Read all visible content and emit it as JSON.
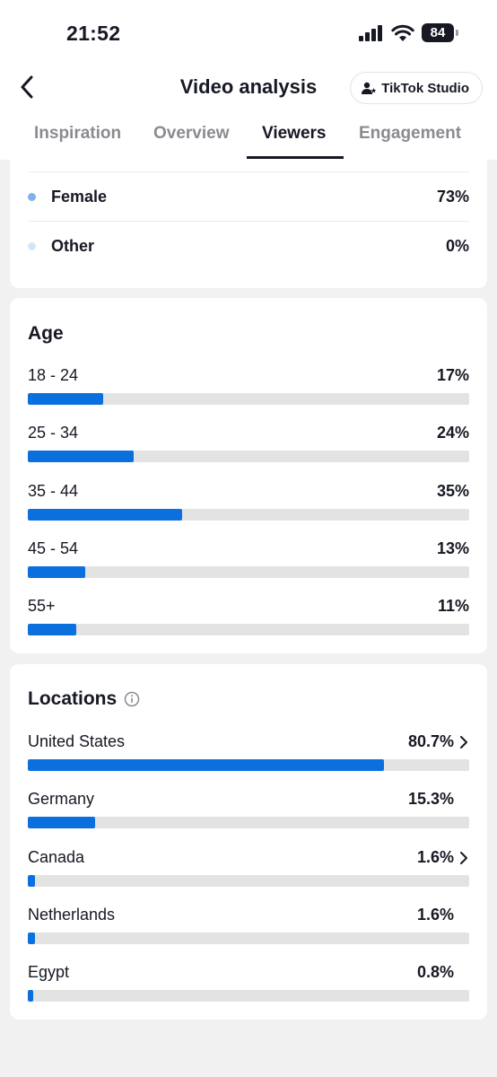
{
  "status_bar": {
    "time": "21:52",
    "battery": "84"
  },
  "header": {
    "title": "Video analysis",
    "studio_button": "TikTok Studio"
  },
  "tabs": [
    {
      "label": "Inspiration",
      "active": false
    },
    {
      "label": "Overview",
      "active": false
    },
    {
      "label": "Viewers",
      "active": true
    },
    {
      "label": "Engagement",
      "active": false
    }
  ],
  "gender": {
    "rows": [
      {
        "label": "Female",
        "value": "73%",
        "dot_color": "#7fb2e8"
      },
      {
        "label": "Other",
        "value": "0%",
        "dot_color": "#d4e5f8"
      }
    ]
  },
  "age": {
    "title": "Age",
    "rows": [
      {
        "label": "18 - 24",
        "value": "17%",
        "fraction": 0.17
      },
      {
        "label": "25 - 34",
        "value": "24%",
        "fraction": 0.24
      },
      {
        "label": "35 - 44",
        "value": "35%",
        "fraction": 0.35
      },
      {
        "label": "45 - 54",
        "value": "13%",
        "fraction": 0.13
      },
      {
        "label": "55+",
        "value": "11%",
        "fraction": 0.11
      }
    ]
  },
  "locations": {
    "title": "Locations",
    "rows": [
      {
        "label": "United States",
        "value": "80.7%",
        "fraction": 0.807,
        "has_chevron": true
      },
      {
        "label": "Germany",
        "value": "15.3%",
        "fraction": 0.153,
        "has_chevron": false
      },
      {
        "label": "Canada",
        "value": "1.6%",
        "fraction": 0.016,
        "has_chevron": true
      },
      {
        "label": "Netherlands",
        "value": "1.6%",
        "fraction": 0.016,
        "has_chevron": false
      },
      {
        "label": "Egypt",
        "value": "0.8%",
        "fraction": 0.008,
        "has_chevron": false
      }
    ]
  },
  "colors": {
    "accent": "#0b70dd",
    "track": "#e3e3e4",
    "background": "#f1f1f2"
  }
}
